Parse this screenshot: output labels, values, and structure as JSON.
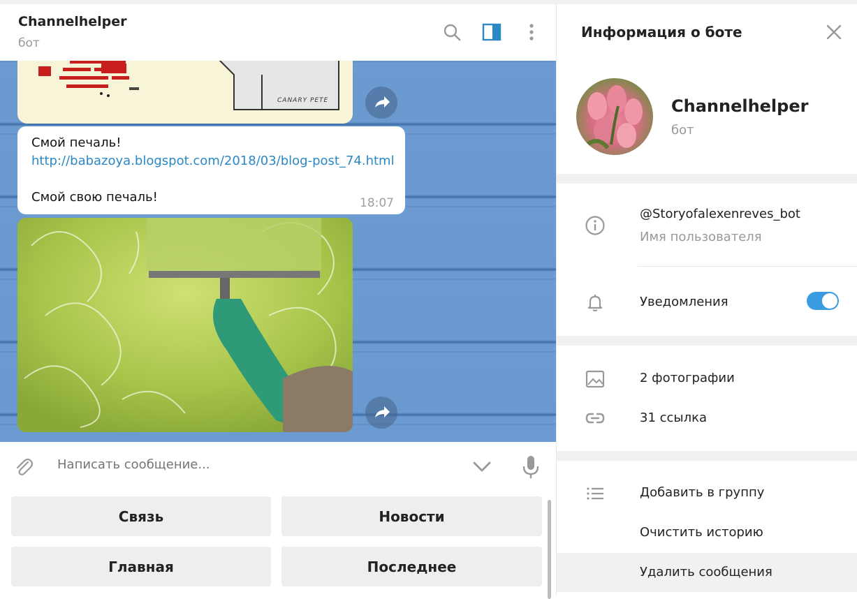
{
  "chat": {
    "title": "Channelhelper",
    "subtitle": "бот",
    "message": {
      "line1": "Смой печаль!",
      "link": "http://babazoya.blogspot.com/2018/03/blog-post_74.html",
      "line3": "Смой свою печаль!",
      "time": "18:07"
    },
    "image_caption": "CANARY PETE",
    "composer_placeholder": "Написать сообщение...",
    "keyboard": [
      "Связь",
      "Новости",
      "Главная",
      "Последнее"
    ]
  },
  "panel": {
    "title": "Информация о боте",
    "bot_name": "Channelhelper",
    "bot_sub": "бот",
    "username": "@Storyofalexenreves_bot",
    "username_label": "Имя пользователя",
    "notifications": "Уведомления",
    "photos": "2 фотографии",
    "links": "31 ссылка",
    "add_to_group": "Добавить в группу",
    "clear_history": "Очистить историю",
    "delete_messages": "Удалить сообщения"
  },
  "colors": {
    "accent": "#3a9be0",
    "link": "#2a88c4",
    "wallpaper": "#6b9bd1"
  },
  "icons": {
    "search": "search-icon",
    "side_panel": "side-panel-icon",
    "more": "more-vertical-icon",
    "forward": "forward-icon",
    "attach": "paperclip-icon",
    "keyboard_toggle": "chevron-down-icon",
    "mic": "microphone-icon",
    "close": "close-icon",
    "info": "info-icon",
    "bell": "bell-icon",
    "photo": "photo-icon",
    "link": "link-icon",
    "list": "list-icon"
  },
  "notifications_enabled": true
}
